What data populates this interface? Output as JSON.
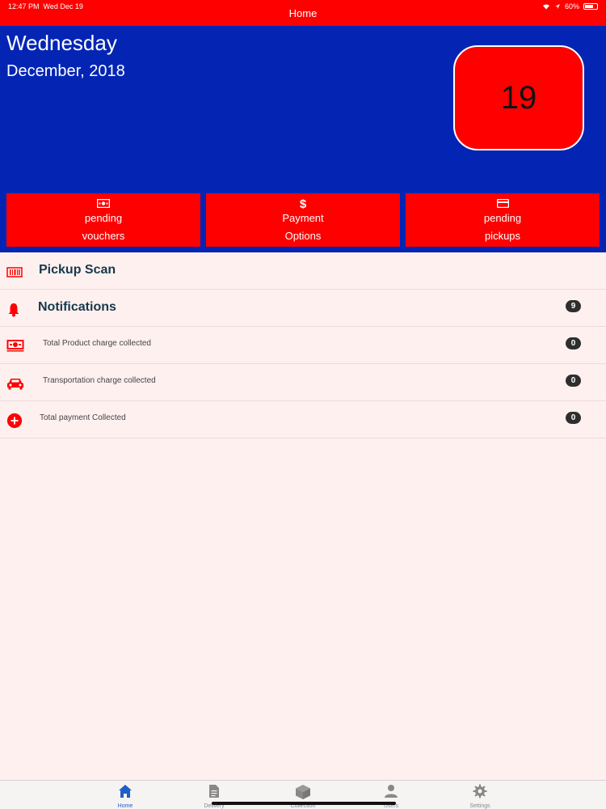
{
  "status_bar": {
    "time": "12:47 PM",
    "date": "Wed Dec 19",
    "title": "Home",
    "battery": "60%"
  },
  "header": {
    "day": "Wednesday",
    "month_year": "December, 2018",
    "day_number": "19"
  },
  "actions": [
    {
      "line1": "pending",
      "line2": "vouchers",
      "icon": "money-icon"
    },
    {
      "line1": "Payment",
      "line2": "Options",
      "icon": "dollar-icon"
    },
    {
      "line1": "pending",
      "line2": "pickups",
      "icon": "card-icon"
    }
  ],
  "list": {
    "pickup_scan": "Pickup Scan",
    "notifications": {
      "label": "Notifications",
      "count": "9"
    },
    "product_charge": {
      "label": "Total Product charge collected",
      "count": "0"
    },
    "transport_charge": {
      "label": "Transportation charge collected",
      "count": "0"
    },
    "total_payment": {
      "label": "Total payment Collected",
      "count": "0"
    }
  },
  "tabs": [
    {
      "label": "Home",
      "icon": "home-icon",
      "active": true
    },
    {
      "label": "Delivery",
      "icon": "document-icon"
    },
    {
      "label": "Collection",
      "icon": "box-icon"
    },
    {
      "label": "Users",
      "icon": "user-icon"
    },
    {
      "label": "Settings",
      "icon": "gear-icon"
    }
  ],
  "colors": {
    "accent_red": "#fe0000",
    "header_blue": "#0425b4",
    "background": "#fff0f0",
    "active_tab": "#1e5fc8"
  }
}
